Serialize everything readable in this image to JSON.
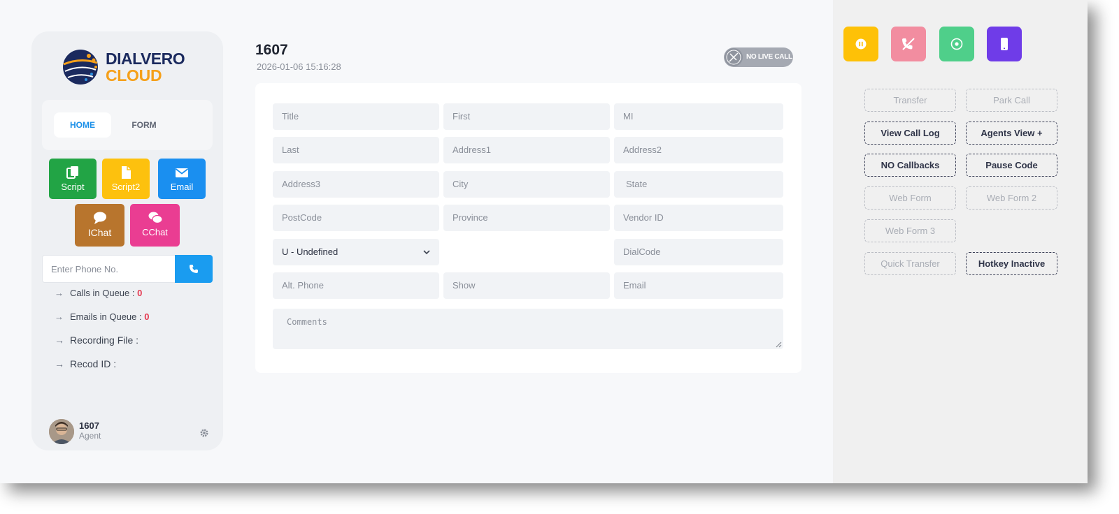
{
  "brand": {
    "line1": "DIALVERO",
    "line2": "CLOUD"
  },
  "tabs": {
    "home": "HOME",
    "form": "FORM"
  },
  "tools": {
    "script": "Script",
    "script2": "Script2",
    "email": "Email",
    "ichat": "IChat",
    "cchat": "CChat"
  },
  "phone": {
    "placeholder": "Enter Phone No."
  },
  "queue": {
    "calls_label": "Calls in Queue :",
    "calls_value": "0",
    "emails_label": "Emails in Queue :",
    "emails_value": "0",
    "recording_label": "Recording File :",
    "record_id_label": "Recod ID :"
  },
  "user": {
    "name": "1607",
    "role": "Agent"
  },
  "header": {
    "agent_id": "1607",
    "timestamp": "2026-01-06 15:16:28",
    "call_status": "NO LIVE CALL"
  },
  "form": {
    "title": "Title",
    "first": "First",
    "mi": "MI",
    "last": "Last",
    "address1": "Address1",
    "address2": "Address2",
    "address3": "Address3",
    "city": "City",
    "state": "State",
    "postcode": "PostCode",
    "province": "Province",
    "vendor_id": "Vendor ID",
    "gender_selected": "U - Undefined",
    "dialcode": "DialCode",
    "alt_phone": "Alt. Phone",
    "show": "Show",
    "email": "Email",
    "comments": "Comments"
  },
  "controls": {
    "transfer": "Transfer",
    "park_call": "Park Call",
    "view_call_log": "View Call Log",
    "agents_view": "Agents View +",
    "no_callbacks": "NO Callbacks",
    "pause_code": "Pause Code",
    "web_form": "Web Form",
    "web_form_2": "Web Form 2",
    "web_form_3": "Web Form 3",
    "quick_transfer": "Quick Transfer",
    "hotkey": "Hotkey Inactive"
  },
  "colors": {
    "pause": "#fec107",
    "hangup": "#f28da0",
    "record": "#4fcf8a",
    "mobile": "#6f3ce8",
    "script": "#22a445",
    "script2": "#fdc10e",
    "email": "#1a8ff0",
    "ichat": "#b8752d",
    "cchat": "#ea3d92"
  }
}
